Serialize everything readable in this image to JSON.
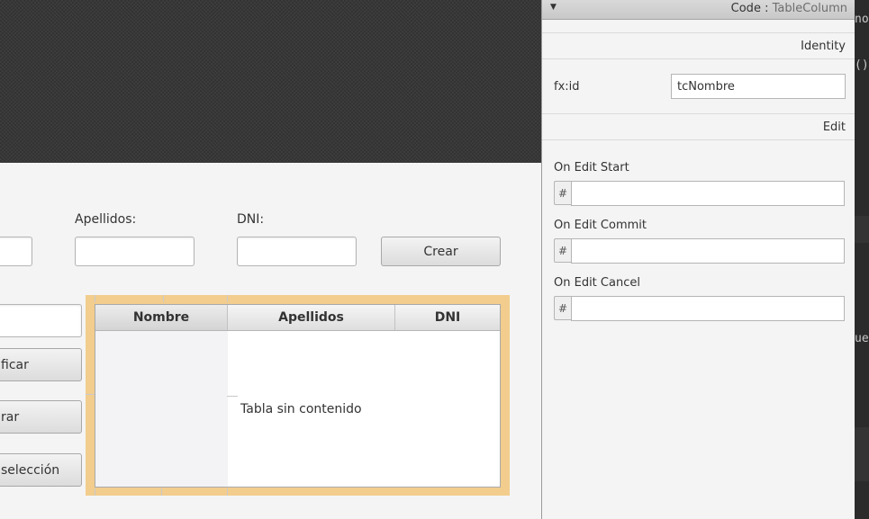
{
  "form": {
    "apellidos_label": "Apellidos:",
    "dni_label": "DNI:",
    "crear_button": "Crear",
    "modificar_button": "ficar",
    "borrar_button": "rar",
    "seleccion_button": "selección"
  },
  "table": {
    "columns": [
      "Nombre",
      "Apellidos",
      "DNI"
    ],
    "placeholder": "Tabla sin contenido",
    "selected_column": "Nombre",
    "highlight_color": "#f2cd8e"
  },
  "inspector": {
    "title_prefix": "Code : ",
    "title_class": "TableColumn",
    "identity_section": "Identity",
    "fx_id_label": "fx:id",
    "fx_id_value": "tcNombre",
    "edit_section": "Edit",
    "hash_symbol": "#",
    "on_edit_start_label": "On Edit Start",
    "on_edit_commit_label": "On Edit Commit",
    "on_edit_cancel_label": "On Edit Cancel"
  },
  "code_strip": {
    "frag1": "no",
    "frag2": "()",
    "frag3": "ue"
  }
}
